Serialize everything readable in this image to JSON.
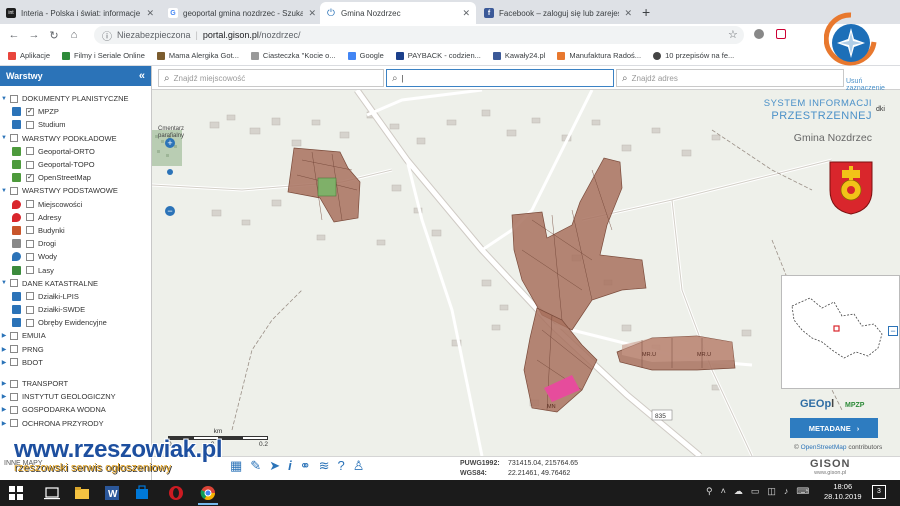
{
  "browser": {
    "tabs": [
      {
        "title": "Interia - Polska i świat: informacje",
        "favicon_color": "#1e1e1e",
        "favicon_text": "int",
        "active": false
      },
      {
        "title": "geoportal gmina nozdrzec - Szukaj",
        "favicon_color": "#4285f4",
        "favicon_text": "G",
        "active": false
      },
      {
        "title": "Gmina Nozdrzec",
        "favicon_color": "#2b73b8",
        "favicon_text": "",
        "active": true
      },
      {
        "title": "Facebook – zaloguj się lub zarejestruj",
        "favicon_color": "#3b5998",
        "favicon_text": "f",
        "active": false
      }
    ],
    "address": {
      "security": "Niezabezpieczona",
      "separator": "|",
      "host": "portal.gison.pl",
      "path": "/nozdrzec/"
    },
    "bookmarks": [
      {
        "label": "Aplikacje",
        "color": "#e8453c"
      },
      {
        "label": "Filmy i Seriale Online",
        "color": "#2e8b3a"
      },
      {
        "label": "Mama Alergika Got...",
        "color": "#7b5c2e"
      },
      {
        "label": "Ciasteczka \"Kocie o...",
        "color": "#999999"
      },
      {
        "label": "Google",
        "color": "#4285f4"
      },
      {
        "label": "PAYBACK - codzien...",
        "color": "#1b3f8b"
      },
      {
        "label": "Kawały24.pl",
        "color": "#3b5998"
      },
      {
        "label": "Manufaktura Radoś...",
        "color": "#e8782e"
      },
      {
        "label": "10 przepisów na fe...",
        "color": "#444444"
      }
    ]
  },
  "sidebar": {
    "title": "Warstwy",
    "collapse": "«",
    "groups": [
      {
        "label": "DOKUMENTY PLANISTYCZNE",
        "items": [
          {
            "label": "MPZP",
            "checked": true,
            "icon": "document-icon"
          },
          {
            "label": "Studium",
            "checked": false,
            "icon": "document-icon"
          }
        ]
      },
      {
        "label": "WARSTWY PODKŁADOWE",
        "items": [
          {
            "label": "Geoportal-ORTO",
            "checked": false,
            "icon": "map-icon"
          },
          {
            "label": "Geoportal-TOPO",
            "checked": false,
            "icon": "map-icon"
          },
          {
            "label": "OpenStreetMap",
            "checked": true,
            "icon": "map-icon"
          }
        ]
      },
      {
        "label": "WARSTWY PODSTAWOWE",
        "items": [
          {
            "label": "Miejscowości",
            "checked": false,
            "icon": "pin-icon"
          },
          {
            "label": "Adresy",
            "checked": false,
            "icon": "pin-icon"
          },
          {
            "label": "Budynki",
            "checked": false,
            "icon": "building-icon"
          },
          {
            "label": "Drogi",
            "checked": false,
            "icon": "road-icon"
          },
          {
            "label": "Wody",
            "checked": false,
            "icon": "water-icon"
          },
          {
            "label": "Lasy",
            "checked": false,
            "icon": "tree-icon"
          }
        ]
      },
      {
        "label": "DANE KATASTRALNE",
        "items": [
          {
            "label": "Działki-LPIS",
            "checked": false,
            "icon": "parcel-icon"
          },
          {
            "label": "Działki-SWDE",
            "checked": false,
            "icon": "parcel-icon"
          },
          {
            "label": "Obręby Ewidencyjne",
            "checked": false,
            "icon": "parcel-icon"
          }
        ]
      }
    ],
    "collapsed": [
      "EMUIA",
      "PRNG",
      "BDOT",
      "TRANSPORT",
      "INSTYTUT GEOLOGICZNY",
      "GOSPODARKA WODNA",
      "OCHRONA PRZYRODY"
    ],
    "bottom_label": "INNE MAPY"
  },
  "search": {
    "locality_placeholder": "Znajdź miejscowość",
    "main_value": "|",
    "address_placeholder": "Znajdź adres"
  },
  "map": {
    "cemetery_label_1": "Cmentarz",
    "cemetery_label_2": "parafialny",
    "road_number": "835",
    "parcel_labels": [
      "MR.U",
      "MR.U",
      "MN"
    ]
  },
  "branding": {
    "line1": "SYSTEM INFORMACJI",
    "line2": "PRZESTRZENNEJ",
    "gmina": "Gmina Nozdrzec",
    "top_right": "Usuń zaznaczenie",
    "top_right2": "dki"
  },
  "overview_toggle": "−",
  "geopl": {
    "main": "GEOp",
    "suffix": "l",
    "mpzp": "MPZP"
  },
  "metadane": {
    "label": "METADANE",
    "arrow": "›"
  },
  "osm": {
    "prefix": "©",
    "link": "OpenStreetMap",
    "suffix": "contributors"
  },
  "coordinates": {
    "puwg_label": "PUWG1992:",
    "puwg_value": "731415.04, 215764.65",
    "wgs_label": "WGS84:",
    "wgs_value": "22.21461, 49.76462"
  },
  "scale": {
    "unit": "km",
    "ticks": [
      "0",
      "0.1",
      "0.2"
    ]
  },
  "gison": {
    "name": "GISON",
    "url": "www.gison.pl"
  },
  "watermark": {
    "site": "www.rzeszowiak.pl",
    "tagline": "rzeszowski serwis ogłoszeniowy"
  },
  "taskbar": {
    "time": "18:06",
    "date": "28.10.2019",
    "notifications": "3"
  },
  "colors": {
    "accent": "#2b73b8",
    "parcel": "#a8715e",
    "watermark_blue": "#1d4f9f",
    "watermark_orange": "#e0a020"
  }
}
